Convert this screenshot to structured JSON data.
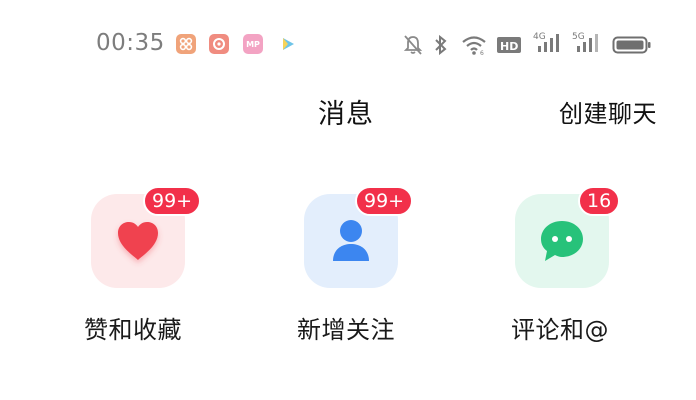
{
  "status_bar": {
    "time": "00:35",
    "app_icons": [
      {
        "name": "app-icon-1",
        "glyph": "",
        "color": "#f0a37a"
      },
      {
        "name": "app-icon-2",
        "glyph": "",
        "color": "#f08c80"
      },
      {
        "name": "app-icon-3",
        "glyph": "MP",
        "color": "#f3a3c3"
      },
      {
        "name": "app-icon-4",
        "glyph": "",
        "color": "#6ec4e8"
      }
    ],
    "system_icons": [
      "mute-bell-icon",
      "bluetooth-icon",
      "wifi-icon",
      "hd-icon",
      "signal-4g-icon",
      "signal-5g-icon",
      "battery-icon"
    ],
    "hd_label": "HD",
    "net1_label": "4G",
    "net2_label": "5G"
  },
  "header": {
    "title": "消息",
    "create_chat": "创建聊天"
  },
  "tiles": [
    {
      "id": "likes",
      "label": "赞和收藏",
      "badge": "99+",
      "icon": "heart-icon",
      "icon_color": "#f0424f",
      "bg": "#fde9ea"
    },
    {
      "id": "follows",
      "label": "新增关注",
      "badge": "99+",
      "icon": "person-icon",
      "icon_color": "#3c86f0",
      "bg": "#e3eefc"
    },
    {
      "id": "comments",
      "label": "评论和@",
      "badge": "16",
      "icon": "chat-bubble-icon",
      "icon_color": "#27c27a",
      "bg": "#e3f7ee"
    }
  ],
  "colors": {
    "badge": "#f2304a",
    "time": "#7d7d7d"
  }
}
